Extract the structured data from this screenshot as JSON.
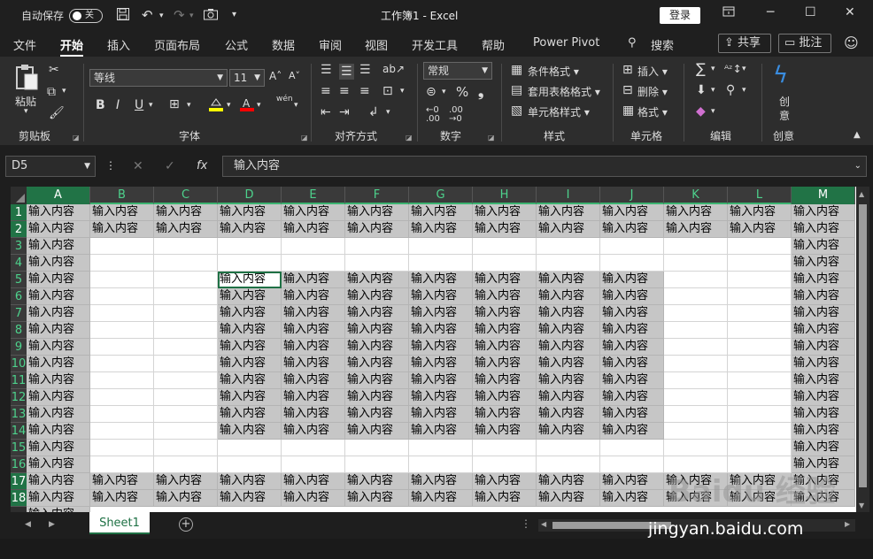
{
  "titlebar": {
    "autosave_label": "自动保存",
    "autosave_state": "关",
    "document_title": "工作簿1  -  Excel",
    "login_label": "登录"
  },
  "ribbon_tabs": [
    "文件",
    "开始",
    "插入",
    "页面布局",
    "公式",
    "数据",
    "审阅",
    "视图",
    "开发工具",
    "帮助",
    "Power Pivot",
    "搜索"
  ],
  "active_tab": "开始",
  "share_label": "共享",
  "comment_label": "批注",
  "ribbon": {
    "clipboard": {
      "paste": "粘贴",
      "group": "剪贴板"
    },
    "font": {
      "name": "等线",
      "size": "11",
      "group": "字体",
      "bold": "B",
      "italic": "I",
      "underline": "U",
      "phonetic": "wén"
    },
    "alignment": {
      "group": "对齐方式"
    },
    "number": {
      "format": "常规",
      "group": "数字"
    },
    "styles": {
      "conditional": "条件格式",
      "table": "套用表格格式",
      "cell": "单元格样式",
      "group": "样式"
    },
    "cells": {
      "insert": "插入",
      "delete": "删除",
      "format": "格式",
      "group": "单元格"
    },
    "editing": {
      "group": "编辑"
    },
    "creative": {
      "label1": "创",
      "label2": "意",
      "group": "创意"
    }
  },
  "formula_bar": {
    "name_box": "D5",
    "fx": "fx",
    "content": "输入内容"
  },
  "grid": {
    "columns": [
      "A",
      "B",
      "C",
      "D",
      "E",
      "F",
      "G",
      "H",
      "I",
      "J",
      "K",
      "L",
      "M"
    ],
    "rows": [
      "1",
      "2",
      "3",
      "4",
      "5",
      "6",
      "7",
      "8",
      "9",
      "10",
      "11",
      "12",
      "13",
      "14",
      "15",
      "16",
      "17",
      "18"
    ],
    "cell_text": "输入内容",
    "full_rows": [
      1,
      2,
      17,
      18
    ],
    "full_cols": [
      "A",
      "M"
    ],
    "block_rows": [
      5,
      14
    ],
    "block_cols": [
      "D",
      "J"
    ],
    "active_cell": "D5",
    "partial_row_19_text": "输入内容"
  },
  "sheets": [
    "Sheet1"
  ],
  "watermark": "jingyan.baidu.com",
  "watermark_logo": "Baidu 经验"
}
